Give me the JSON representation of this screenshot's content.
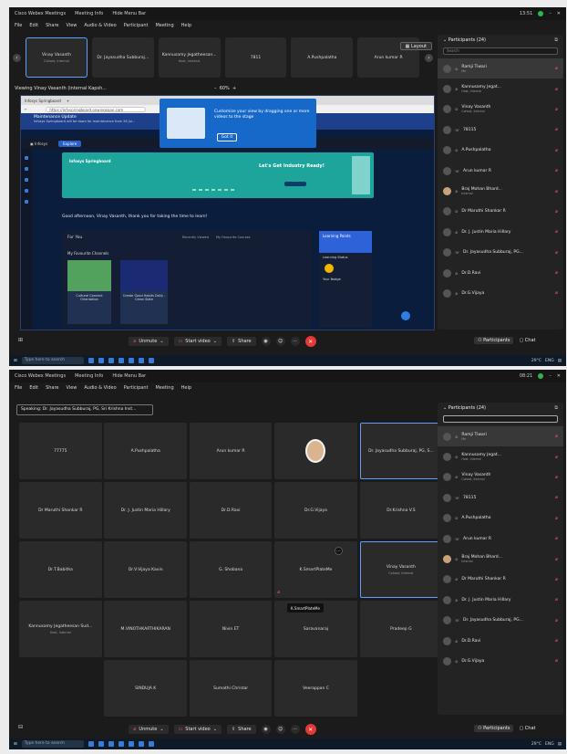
{
  "app": {
    "title": "Cisco Webex Meetings",
    "tab_meeting_info": "Meeting Info",
    "tab_hide_menu": "Hide Menu Bar",
    "menu": [
      "File",
      "Edit",
      "Share",
      "View",
      "Audio & Video",
      "Participant",
      "Meeting",
      "Help"
    ]
  },
  "frame1": {
    "clock": "13:51",
    "strip": [
      {
        "name": "Vinay Vasanth",
        "sub": "Cohost, Internal"
      },
      {
        "name": "Dr. Jayasudha Subburaj...",
        "sub": ""
      },
      {
        "name": "Kannusamy Jegatheesan...",
        "sub": "Host, Internal"
      },
      {
        "name": "7811",
        "sub": ""
      },
      {
        "name": "A.Pushpalatha",
        "sub": ""
      },
      {
        "name": "Arun kumar R",
        "sub": ""
      }
    ],
    "layout_label": "Layout",
    "viewing": "Viewing Vinay Vasanth (internal Kapsh...",
    "zoom": "60%",
    "share": {
      "tab": "Infosys Springboard",
      "url": "https://infyspringboard.onwingspan.com",
      "popup_msg": "Customize your view by dragging one or more videos to the stage",
      "popup_btn": "Got it",
      "notice_title": "Maintenance Update",
      "notice_sub": "Infosys Springboard will be down for maintenance from 26 Jul...",
      "site_btn": "Explore",
      "banner_brand": "Infosys Springboard",
      "banner_heading": "Let's Get Industry Ready!",
      "greeting": "Good afternoon, Vinay Vasanth, thank you for taking the time to learn!",
      "for_you": "For You",
      "tab_recent": "Recently Viewed",
      "tab_my_courses": "My Favourite Courses",
      "fav_title": "My Favourite Channels",
      "course1": "Cultural Connect Orientation",
      "course2": "Create Good Habits Daily - Clean Slate",
      "learning_points": "Learning Points",
      "learn_status": "Learning Status",
      "your_badge": "Your Badge"
    },
    "toolbar": {
      "unmute": "Unmute",
      "start_video": "Start video",
      "share": "Share",
      "participants": "Participants",
      "chat": "Chat"
    }
  },
  "frame2": {
    "clock": "08:21",
    "speaking": "Speaking: Dr. Jayasudha Subburaj, PG, Sri Krishna Inst...",
    "grid": [
      {
        "name": "77775",
        "sub": ""
      },
      {
        "name": "A.Pushpalatha",
        "sub": ""
      },
      {
        "name": "Arun kumar R",
        "sub": ""
      },
      {
        "name": "",
        "sub": "",
        "face": true
      },
      {
        "name": "Dr. Jayasudha Subburaj, PG, S...",
        "sub": "",
        "hl": true
      },
      {
        "name": "Dr Maruthi Shankar R",
        "sub": ""
      },
      {
        "name": "Dr. J. Justin Maria Hillary",
        "sub": ""
      },
      {
        "name": "Dr.D.Ravi",
        "sub": ""
      },
      {
        "name": "Dr.G.Vijaya",
        "sub": ""
      },
      {
        "name": "Dr.Krishna V.S",
        "sub": ""
      },
      {
        "name": "Dr.T.Babitha",
        "sub": ""
      },
      {
        "name": "Dr.V.Vijaya Kavin",
        "sub": ""
      },
      {
        "name": "G. Shobana",
        "sub": ""
      },
      {
        "name": "K.SmartPlateMe",
        "sub": ""
      },
      {
        "name": "Vinay Vasanth",
        "sub": "Cohost, Internal",
        "hl": true
      },
      {
        "name": "Kannusamy Jegatheesan Sud...",
        "sub": "Host, Internal"
      },
      {
        "name": "M.VINOTHKARTHIKARAN",
        "sub": ""
      },
      {
        "name": "Nivin ET",
        "sub": ""
      },
      {
        "name": "Saravanaraj",
        "sub": ""
      },
      {
        "name": "Pradeep G",
        "sub": ""
      },
      {
        "name": "SINDUJA K",
        "sub": ""
      },
      {
        "name": "Sumathi Christar",
        "sub": ""
      },
      {
        "name": "Veerappan C",
        "sub": ""
      }
    ],
    "tooltip": "K.SmartPlateMe",
    "toolbar": {
      "unmute": "Unmute",
      "start_video": "Start video",
      "share": "Share",
      "participants": "Participants",
      "chat": "Chat"
    }
  },
  "participants": {
    "title": "Participants (24)",
    "search_placeholder": "Search",
    "list": [
      {
        "name": "Ramji Tiwari",
        "sub": "Me"
      },
      {
        "name": "Kannusamy Jegat...",
        "sub": "Host, Internal"
      },
      {
        "name": "Vinay Vasanth",
        "sub": "Cohost, Internal"
      },
      {
        "name": "78115",
        "sub": ""
      },
      {
        "name": "A.Pushpalatha",
        "sub": ""
      },
      {
        "name": "Arun kumar R",
        "sub": ""
      },
      {
        "name": "Braj Mohan Bhard...",
        "sub": "Internal"
      },
      {
        "name": "Dr Maruthi Shankar R",
        "sub": ""
      },
      {
        "name": "Dr. J. Justin Maria Hillary",
        "sub": ""
      },
      {
        "name": "Dr. Jayasudha Subburaj, PG...",
        "sub": ""
      },
      {
        "name": "Dr.D.Ravi",
        "sub": ""
      },
      {
        "name": "Dr.G.Vijaya",
        "sub": ""
      }
    ]
  },
  "taskbar": {
    "search": "Type here to search",
    "weather": "29°C",
    "lang": "ENG"
  }
}
